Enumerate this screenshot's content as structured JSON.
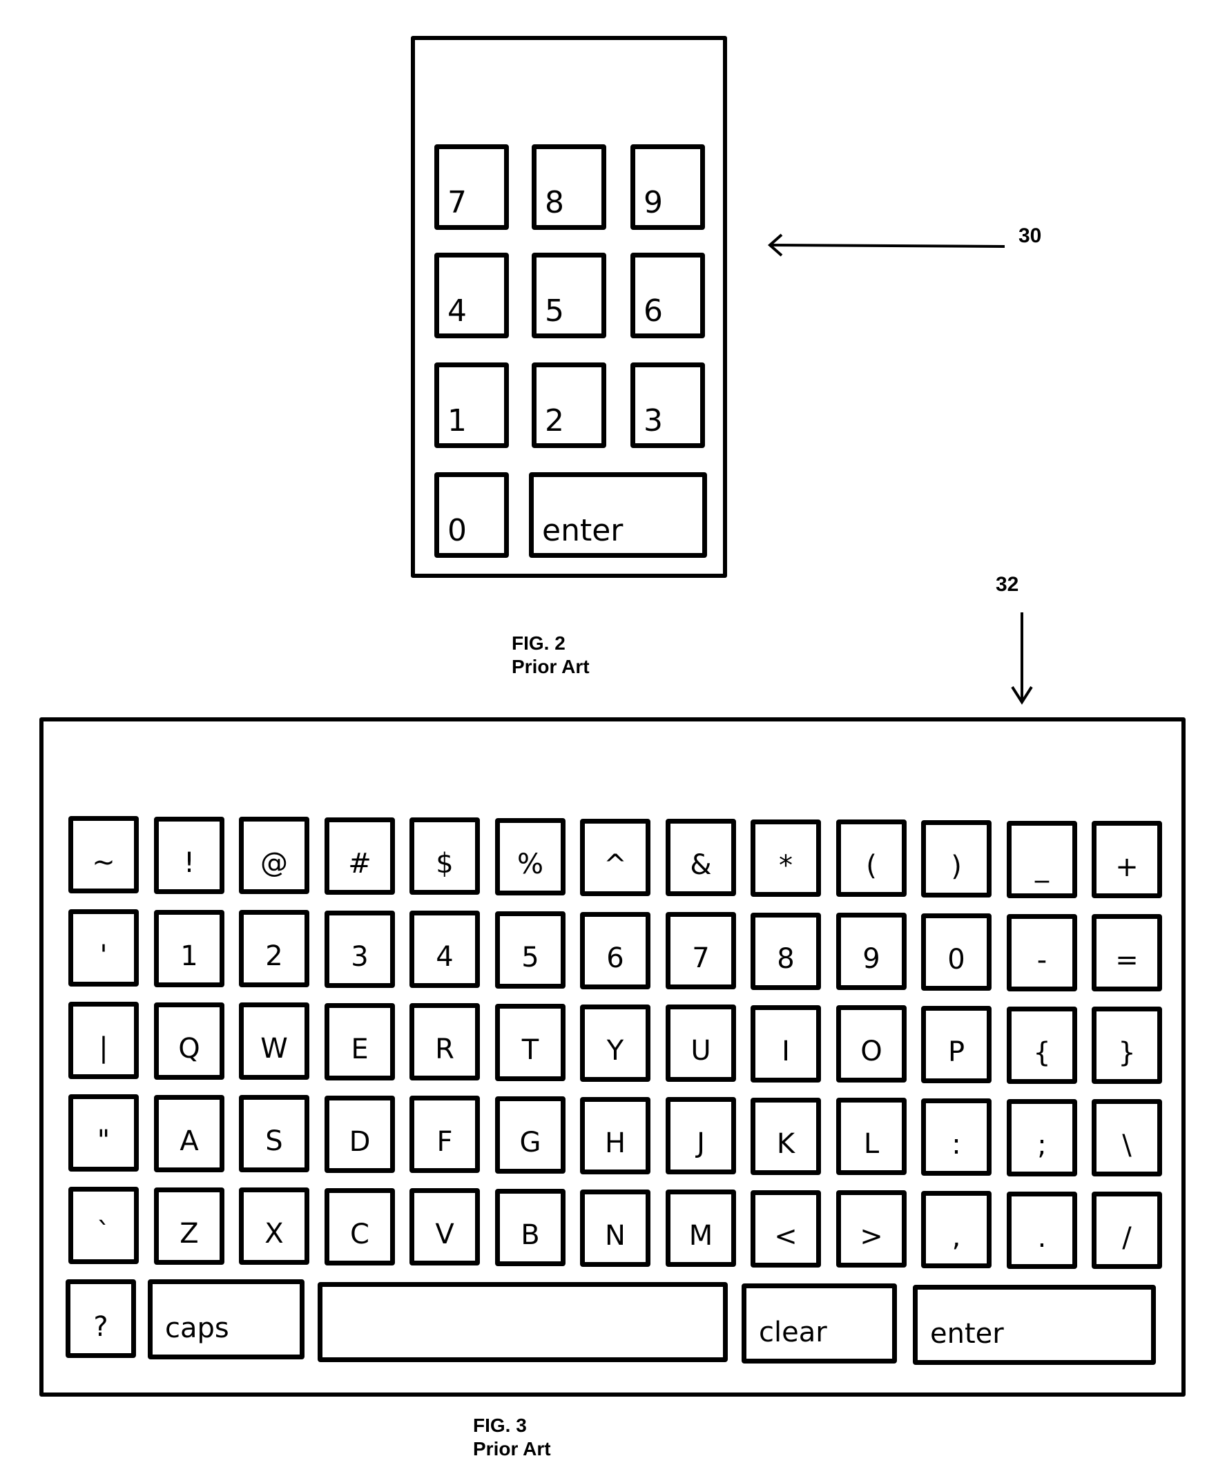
{
  "fig2": {
    "ref_number": "30",
    "caption_line1": "FIG. 2",
    "caption_line2": "Prior Art",
    "keys": [
      "7",
      "8",
      "9",
      "4",
      "5",
      "6",
      "1",
      "2",
      "3",
      "0",
      "enter"
    ]
  },
  "fig3": {
    "ref_number": "32",
    "caption_line1": "FIG. 3",
    "caption_line2": "Prior Art",
    "rows": [
      [
        "~",
        "!",
        "@",
        "#",
        "$",
        "%",
        "^",
        "&",
        "*",
        "(",
        ")",
        "_",
        "+"
      ],
      [
        "'",
        "1",
        "2",
        "3",
        "4",
        "5",
        "6",
        "7",
        "8",
        "9",
        "0",
        "-",
        "="
      ],
      [
        "|",
        "Q",
        "W",
        "E",
        "R",
        "T",
        "Y",
        "U",
        "I",
        "O",
        "P",
        "{",
        "}"
      ],
      [
        "\"",
        "A",
        "S",
        "D",
        "F",
        "G",
        "H",
        "J",
        "K",
        "L",
        ":",
        ";",
        "\\"
      ],
      [
        "`",
        "Z",
        "X",
        "C",
        "V",
        "B",
        "N",
        "M",
        "<",
        ">",
        ",",
        ".",
        "/"
      ]
    ],
    "bottom_row": {
      "question": "?",
      "caps": "caps",
      "space": "",
      "clear": "clear",
      "enter": "enter"
    }
  }
}
